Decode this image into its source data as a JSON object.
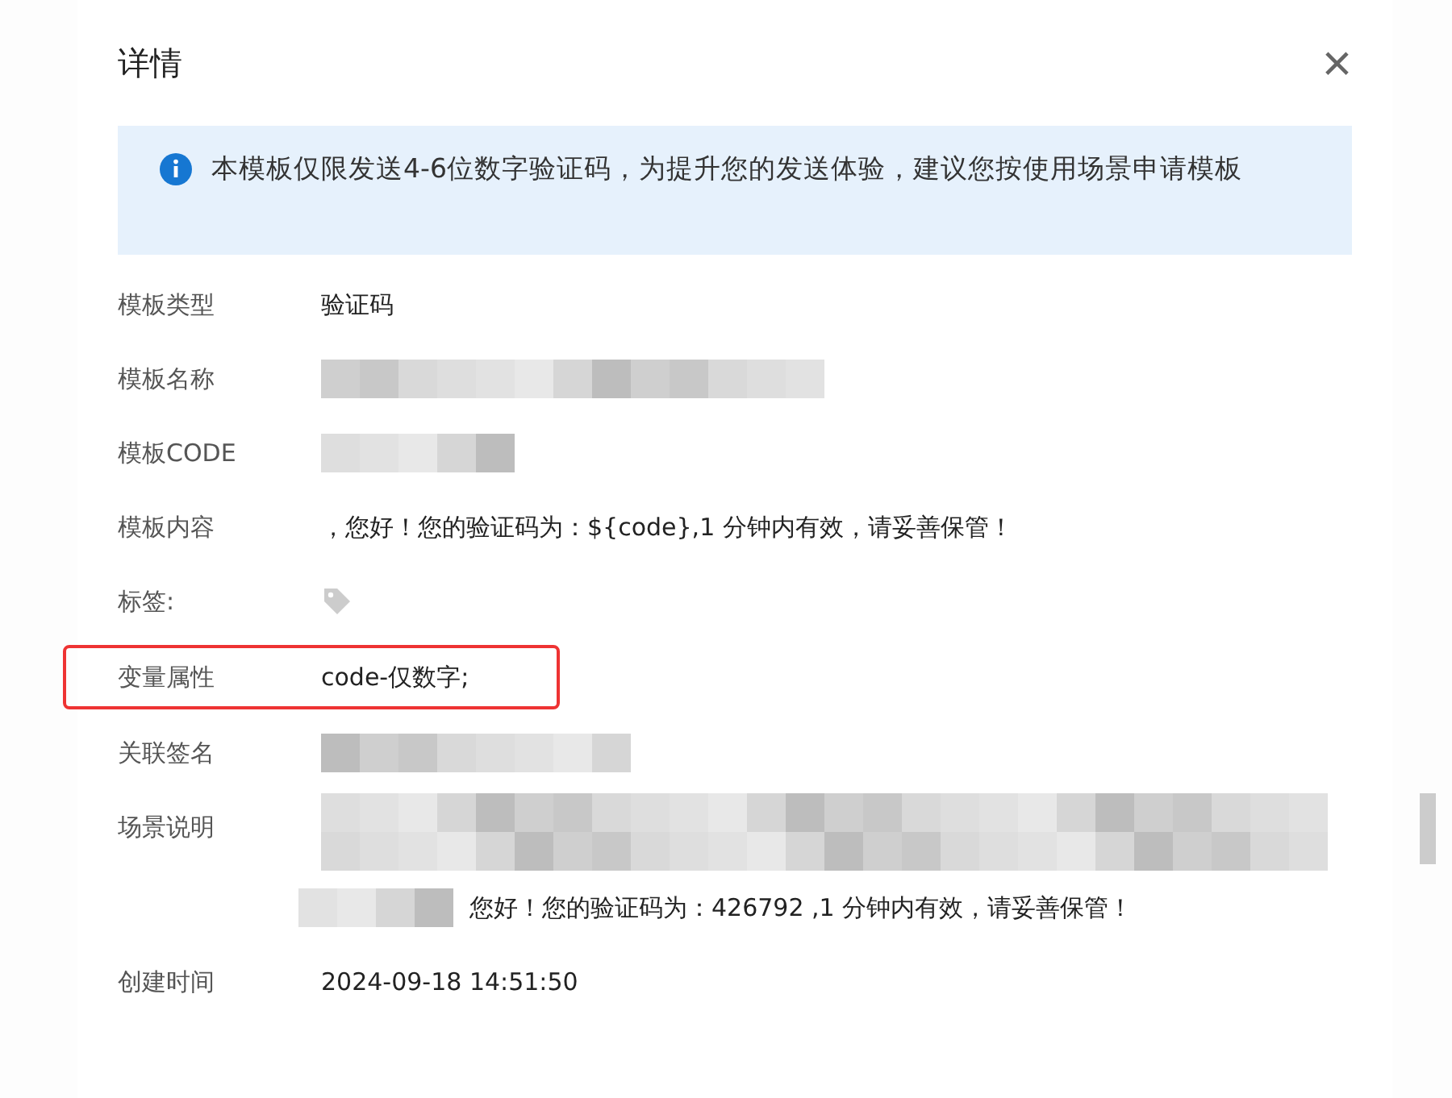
{
  "dialog": {
    "title": "详情",
    "close": "×"
  },
  "notice": {
    "text": "本模板仅限发送4-6位数字验证码，为提升您的发送体验，建议您按使用场景申请模板"
  },
  "fields": [
    {
      "label": "模板类型",
      "kind": "text",
      "value": "验证码",
      "highlighted": false
    },
    {
      "label": "模板名称",
      "kind": "redacted",
      "highlighted": false
    },
    {
      "label": "模板CODE",
      "kind": "redacted",
      "highlighted": false
    },
    {
      "label": "模板内容",
      "kind": "text",
      "value": "，您好！您的验证码为：${code},1 分钟内有效，请妥善保管！",
      "highlighted": false
    },
    {
      "label": "标签:",
      "kind": "tag",
      "highlighted": false
    },
    {
      "label": "变量属性",
      "kind": "text",
      "value": "code-仅数字;",
      "highlighted": true
    },
    {
      "label": "关联签名",
      "kind": "redacted",
      "highlighted": false
    },
    {
      "label": "场景说明",
      "kind": "redacted-lines",
      "value": "您好！您的验证码为：426792 ,1 分钟内有效，请妥善保管！",
      "highlighted": false
    },
    {
      "label": "创建时间",
      "kind": "text",
      "value": "2024-09-18 14:51:50",
      "highlighted": false
    }
  ]
}
